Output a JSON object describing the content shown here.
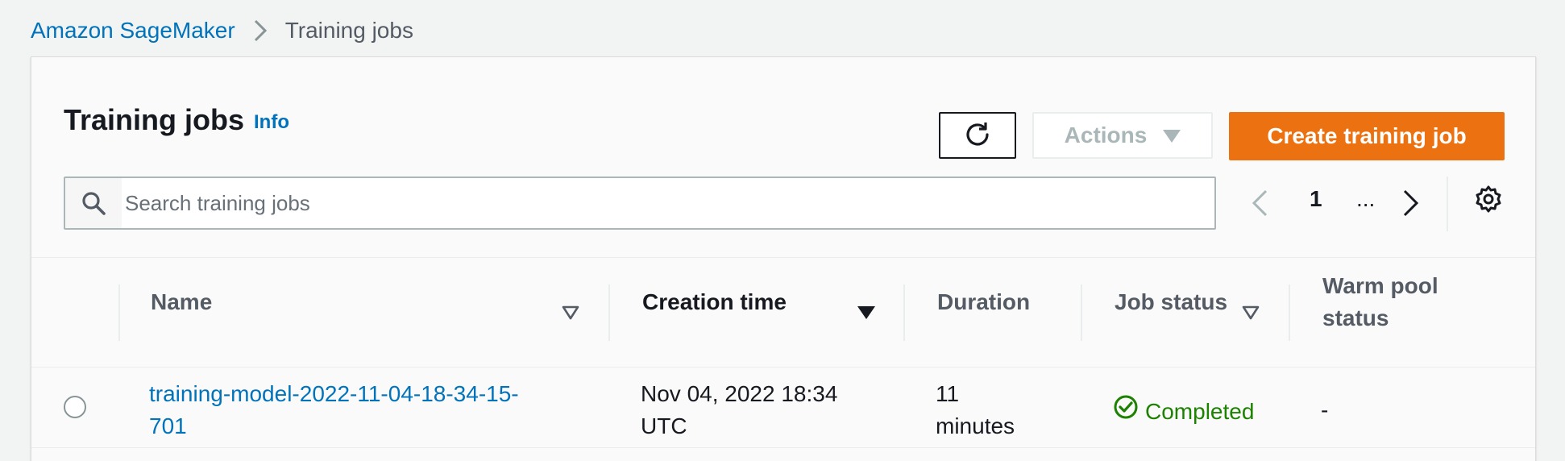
{
  "breadcrumb": {
    "root": "Amazon SageMaker",
    "current": "Training jobs"
  },
  "header": {
    "title": "Training jobs",
    "info": "Info"
  },
  "toolbar": {
    "actions_label": "Actions",
    "create_label": "Create training job"
  },
  "search": {
    "placeholder": "Search training jobs",
    "value": ""
  },
  "pagination": {
    "current_page": "1",
    "ellipsis": "..."
  },
  "table": {
    "columns": {
      "name": "Name",
      "creation_time": "Creation time",
      "duration": "Duration",
      "job_status": "Job status",
      "warm_pool_status_line1": "Warm pool",
      "warm_pool_status_line2": "status"
    },
    "rows": [
      {
        "name_line1": "training-model-2022-11-04-18-34-15-",
        "name_line2": "701",
        "creation_line1": "Nov 04, 2022 18:34",
        "creation_line2": "UTC",
        "duration_line1": "11",
        "duration_line2": "minutes",
        "job_status": "Completed",
        "warm_pool_status": "-"
      }
    ]
  },
  "colors": {
    "link": "#0073bb",
    "primary_button": "#ec7211",
    "success": "#1d8102",
    "disabled_text": "#aab7b8"
  },
  "icons": [
    "chevron-right-icon",
    "refresh-icon",
    "caret-down-icon",
    "search-icon",
    "chevron-left-icon",
    "settings-gear-icon",
    "sort-icon",
    "check-circle-icon"
  ]
}
